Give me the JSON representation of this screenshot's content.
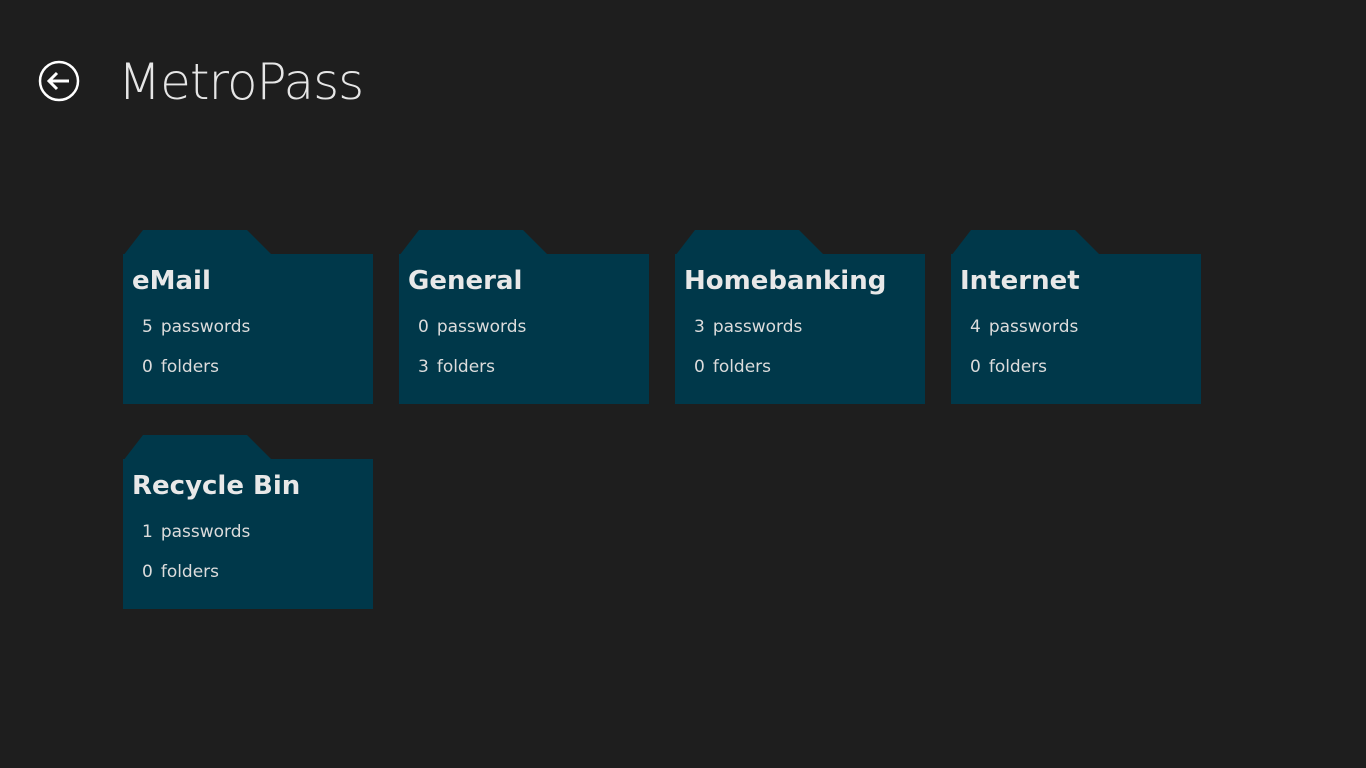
{
  "app": {
    "title": "MetroPass"
  },
  "colors": {
    "background": "#1e1e1e",
    "tile": "#00384a",
    "text": "#e6e6e6"
  },
  "icons": {
    "back": "back-arrow-circle-icon"
  },
  "folders": [
    {
      "name": "eMail",
      "passwords_count": "5",
      "passwords_label": "passwords",
      "folders_count": "0",
      "folders_label": "folders"
    },
    {
      "name": "General",
      "passwords_count": "0",
      "passwords_label": "passwords",
      "folders_count": "3",
      "folders_label": "folders"
    },
    {
      "name": "Homebanking",
      "passwords_count": "3",
      "passwords_label": "passwords",
      "folders_count": "0",
      "folders_label": "folders"
    },
    {
      "name": "Internet",
      "passwords_count": "4",
      "passwords_label": "passwords",
      "folders_count": "0",
      "folders_label": "folders"
    },
    {
      "name": "Recycle Bin",
      "passwords_count": "1",
      "passwords_label": "passwords",
      "folders_count": "0",
      "folders_label": "folders"
    }
  ]
}
